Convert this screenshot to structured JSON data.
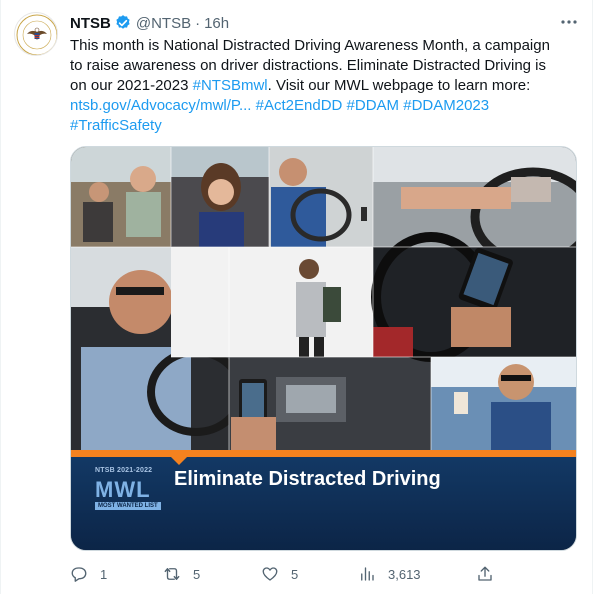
{
  "tweet": {
    "author_name": "NTSB",
    "handle": "@NTSB",
    "separator": "·",
    "time": "16h",
    "more_icon": "more-horizontal-icon",
    "text_lines": [
      [
        {
          "text": "This month is National Distracted Driving Awareness Month, a campaign",
          "link": false
        }
      ],
      [
        {
          "text": "to raise awareness on driver distractions. Eliminate Distracted Driving is",
          "link": false
        }
      ],
      [
        {
          "text": "on our 2021-2023 ",
          "link": false
        },
        {
          "text": "#NTSBmwl",
          "link": true
        },
        {
          "text": ". Visit our MWL webpage to learn more:",
          "link": false
        }
      ],
      [
        {
          "text": "ntsb.gov/Advocacy/mwl/P...",
          "link": true
        },
        {
          "text": " ",
          "link": false
        },
        {
          "text": "#Act2EndDD",
          "link": true
        },
        {
          "text": " ",
          "link": false
        },
        {
          "text": "#DDAM",
          "link": true
        },
        {
          "text": " ",
          "link": false
        },
        {
          "text": "#DDAM2023",
          "link": true
        }
      ],
      [
        {
          "text": "#TrafficSafety",
          "link": true
        }
      ]
    ]
  },
  "media": {
    "banner_small": "NTSB 2021-2022",
    "banner_logo": "MWL",
    "banner_foot": "MOST WANTED LIST",
    "banner_title": "Eliminate Distracted Driving"
  },
  "actions": {
    "reply_count": "1",
    "retweet_count": "5",
    "like_count": "5",
    "views_count": "3,613"
  },
  "colors": {
    "accent": "#1d9bf0",
    "muted": "#536471",
    "banner_orange": "#f5821f",
    "banner_navy": "#133a67"
  }
}
